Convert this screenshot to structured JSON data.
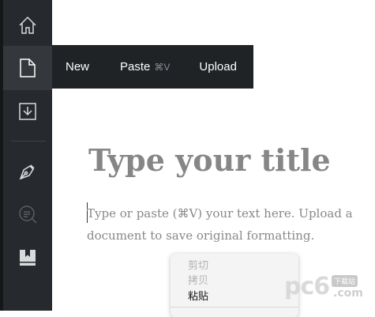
{
  "sidebar": {
    "items": [
      {
        "icon": "home-icon"
      },
      {
        "icon": "new-document-icon"
      },
      {
        "icon": "download-icon"
      },
      {
        "icon": "pen-nib-icon"
      },
      {
        "icon": "search-document-icon"
      },
      {
        "icon": "bookmark-book-icon"
      }
    ]
  },
  "new_menu": {
    "new_label": "New",
    "paste_label": "Paste",
    "paste_shortcut": "⌘V",
    "upload_label": "Upload"
  },
  "editor": {
    "title_placeholder": "Type your title",
    "body_placeholder": "Type or paste (⌘V) your text here. Upload a document to save original formatting."
  },
  "context_menu": {
    "cut": "剪切",
    "copy": "拷贝",
    "paste": "粘贴"
  },
  "watermark": {
    "logo": "pc6",
    "badge": "下载站",
    "url": ".com"
  },
  "colors": {
    "sidebar_bg": "#26292d",
    "menu_bg": "#202326",
    "title_color": "#868686",
    "body_color": "#888888"
  }
}
